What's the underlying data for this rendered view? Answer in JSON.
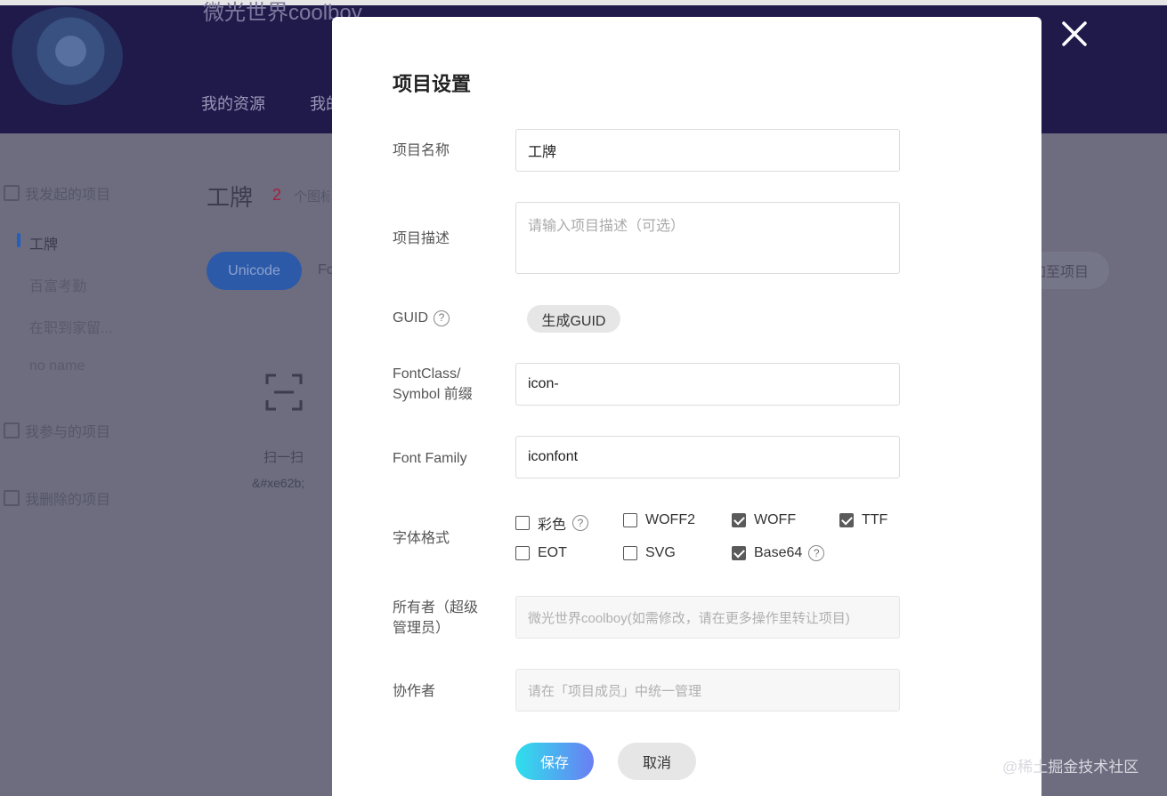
{
  "background": {
    "site_title": "微光世界coolboy",
    "nav": [
      "我的资源",
      "我的"
    ],
    "sidebar": {
      "my_projects": "我发起的项目",
      "projects": [
        "工牌",
        "百富考勤",
        "在职到家留...",
        "no name"
      ],
      "joined": "我参与的项目",
      "deleted": "我删除的项目"
    },
    "project_title": "工牌",
    "icon_count": "2",
    "icon_count_unit": "个图标",
    "tabs": [
      "Unicode",
      "Font"
    ],
    "right_button": "添加至项目",
    "icon_card": {
      "name": "扫一扫",
      "code": "&#xe62b;"
    }
  },
  "modal": {
    "title": "项目设置",
    "fields": {
      "name_label": "项目名称",
      "name_value": "工牌",
      "desc_label": "项目描述",
      "desc_placeholder": "请输入项目描述（可选）",
      "guid_label": "GUID",
      "guid_button": "生成GUID",
      "prefix_label_1": "FontClass/",
      "prefix_label_2": "Symbol 前缀",
      "prefix_value": "icon-",
      "family_label": "Font Family",
      "family_value": "iconfont",
      "format_label": "字体格式",
      "owner_label_1": "所有者（超级",
      "owner_label_2": "管理员）",
      "owner_placeholder": "微光世界coolboy(如需修改，请在更多操作里转让项目)",
      "collab_label": "协作者",
      "collab_placeholder": "请在「项目成员」中统一管理"
    },
    "formats": [
      {
        "label": "彩色",
        "checked": false,
        "help": true
      },
      {
        "label": "WOFF2",
        "checked": false,
        "help": false
      },
      {
        "label": "WOFF",
        "checked": true,
        "help": false
      },
      {
        "label": "TTF",
        "checked": true,
        "help": false
      },
      {
        "label": "EOT",
        "checked": false,
        "help": false
      },
      {
        "label": "SVG",
        "checked": false,
        "help": false
      },
      {
        "label": "Base64",
        "checked": true,
        "help": true
      }
    ],
    "save_label": "保存",
    "cancel_label": "取消",
    "help_glyph": "?"
  },
  "watermark": "@稀土掘金技术社区"
}
